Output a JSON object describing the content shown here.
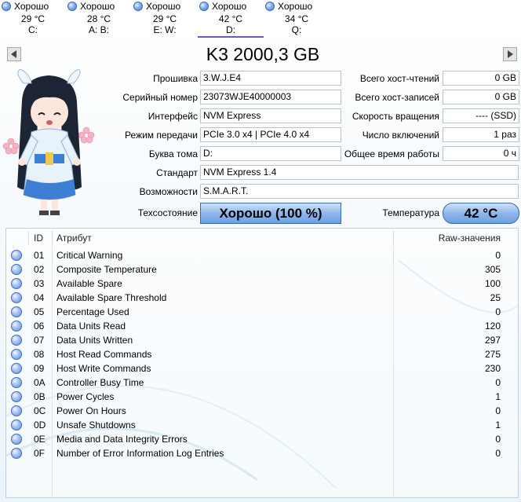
{
  "drives": [
    {
      "status": "Хорошо",
      "temp": "29 °C",
      "letters": "C:"
    },
    {
      "status": "Хорошо",
      "temp": "28 °C",
      "letters": "A: B:"
    },
    {
      "status": "Хорошо",
      "temp": "29 °C",
      "letters": "E: W:"
    },
    {
      "status": "Хорошо",
      "temp": "42 °C",
      "letters": "D:"
    },
    {
      "status": "Хорошо",
      "temp": "34 °C",
      "letters": "Q:"
    }
  ],
  "title": "K3 2000,3 GB",
  "info": {
    "firmware_label": "Прошивка",
    "firmware": "3.W.J.E4",
    "serial_label": "Серийный номер",
    "serial": "23073WJE40000003",
    "interface_label": "Интерфейс",
    "interface": "NVM Express",
    "transfer_label": "Режим передачи",
    "transfer": "PCIe 3.0 x4 | PCIe 4.0 x4",
    "volume_label": "Буква тома",
    "volume": "D:",
    "standard_label": "Стандарт",
    "standard": "NVM Express 1.4",
    "features_label": "Возможности",
    "features": "S.M.A.R.T.",
    "host_reads_label": "Всего хост-чтений",
    "host_reads": "0 GB",
    "host_writes_label": "Всего хост-записей",
    "host_writes": "0 GB",
    "rotation_label": "Скорость вращения",
    "rotation": "---- (SSD)",
    "power_count_label": "Число включений",
    "power_count": "1 раз",
    "power_hours_label": "Общее время работы",
    "power_hours": "0 ч",
    "health_label": "Техсостояние",
    "health": "Хорошо  (100 %)",
    "temp_label": "Температура",
    "temp": "42 °C"
  },
  "table": {
    "headers": {
      "id": "ID",
      "attr": "Атрибут",
      "raw": "Raw-значения"
    },
    "rows": [
      {
        "id": "01",
        "name": "Critical Warning",
        "raw": "0"
      },
      {
        "id": "02",
        "name": "Composite Temperature",
        "raw": "305"
      },
      {
        "id": "03",
        "name": "Available Spare",
        "raw": "100"
      },
      {
        "id": "04",
        "name": "Available Spare Threshold",
        "raw": "25"
      },
      {
        "id": "05",
        "name": "Percentage Used",
        "raw": "0"
      },
      {
        "id": "06",
        "name": "Data Units Read",
        "raw": "120"
      },
      {
        "id": "07",
        "name": "Data Units Written",
        "raw": "297"
      },
      {
        "id": "08",
        "name": "Host Read Commands",
        "raw": "275"
      },
      {
        "id": "09",
        "name": "Host Write Commands",
        "raw": "230"
      },
      {
        "id": "0A",
        "name": "Controller Busy Time",
        "raw": "0"
      },
      {
        "id": "0B",
        "name": "Power Cycles",
        "raw": "1"
      },
      {
        "id": "0C",
        "name": "Power On Hours",
        "raw": "0"
      },
      {
        "id": "0D",
        "name": "Unsafe Shutdowns",
        "raw": "1"
      },
      {
        "id": "0E",
        "name": "Media and Data Integrity Errors",
        "raw": "0"
      },
      {
        "id": "0F",
        "name": "Number of Error Information Log Entries",
        "raw": "0"
      }
    ]
  },
  "colors": {
    "accent": "#7a52c8",
    "health_blue": "#8fb6ea"
  }
}
